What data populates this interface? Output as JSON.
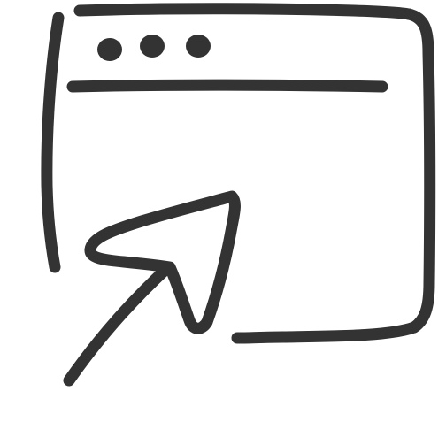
{
  "icon": {
    "name": "browser-window-cursor-icon",
    "stroke_color": "#333333",
    "background_color": "#ffffff",
    "window_control_dots": 3
  }
}
